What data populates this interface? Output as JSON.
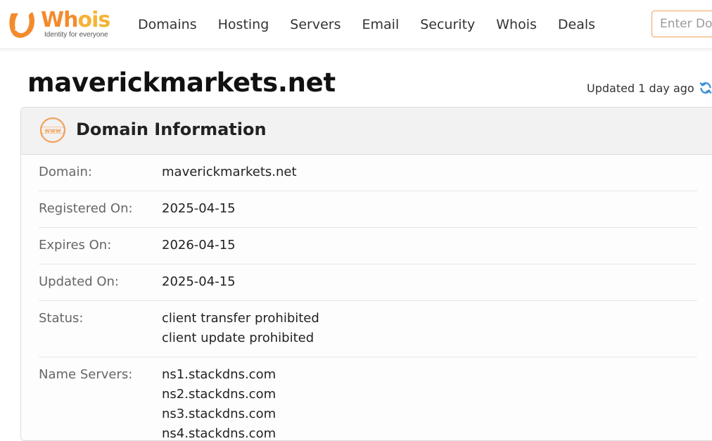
{
  "brand": {
    "name_part1": "Wh",
    "name_part2": "ois",
    "tagline": "Identity for everyone",
    "primary_color": "#f38b2d",
    "secondary_color": "#f5b335"
  },
  "nav": {
    "items": [
      {
        "label": "Domains"
      },
      {
        "label": "Hosting"
      },
      {
        "label": "Servers"
      },
      {
        "label": "Email"
      },
      {
        "label": "Security"
      },
      {
        "label": "Whois"
      },
      {
        "label": "Deals"
      }
    ]
  },
  "search": {
    "placeholder": "Enter Domain",
    "value": ""
  },
  "page": {
    "title": "maverickmarkets.net",
    "updated_text": "Updated 1 day ago",
    "refresh_icon": "refresh-icon",
    "refresh_color": "#3b8fd9"
  },
  "card": {
    "title": "Domain Information",
    "icon": "www-icon",
    "rows": [
      {
        "label": "Domain:",
        "values": [
          "maverickmarkets.net"
        ]
      },
      {
        "label": "Registered On:",
        "values": [
          "2025-04-15"
        ]
      },
      {
        "label": "Expires On:",
        "values": [
          "2026-04-15"
        ]
      },
      {
        "label": "Updated On:",
        "values": [
          "2025-04-15"
        ]
      },
      {
        "label": "Status:",
        "values": [
          "client transfer prohibited",
          "client update prohibited"
        ]
      },
      {
        "label": "Name Servers:",
        "values": [
          "ns1.stackdns.com",
          "ns2.stackdns.com",
          "ns3.stackdns.com",
          "ns4.stackdns.com"
        ]
      }
    ]
  }
}
